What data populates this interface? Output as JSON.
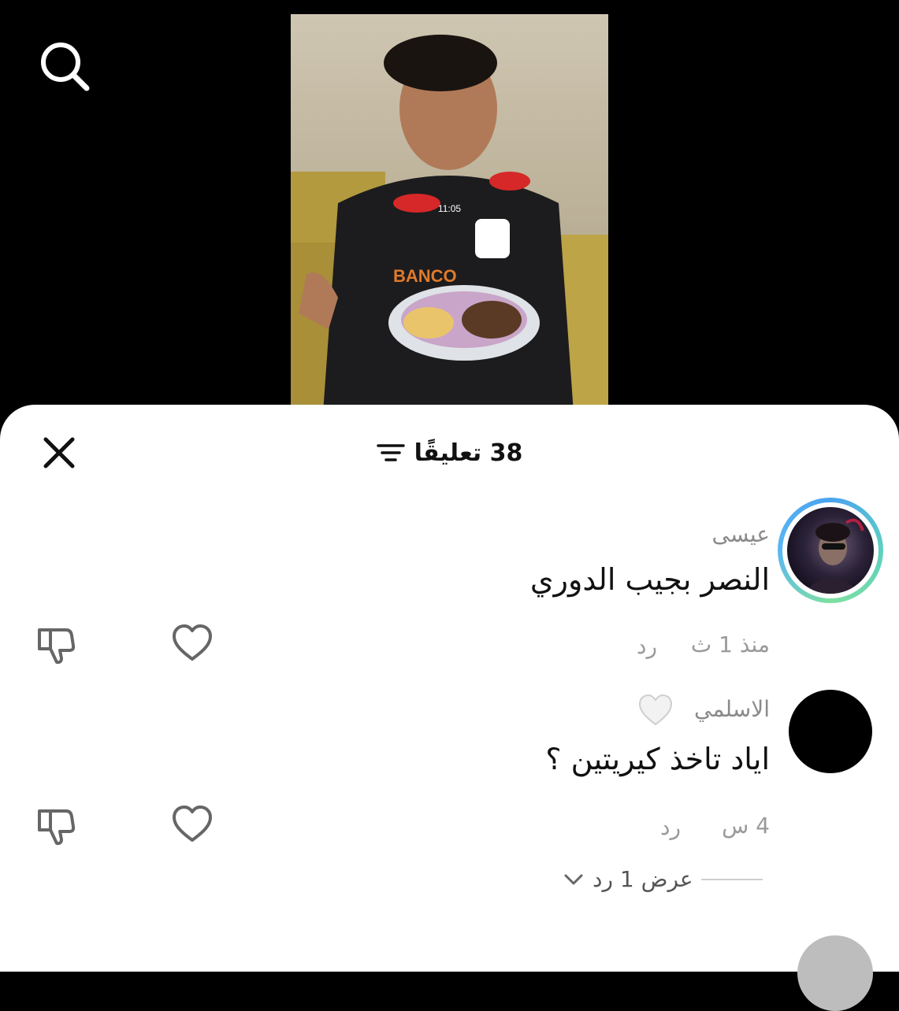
{
  "video": {
    "timestamp": "11:05"
  },
  "sheet": {
    "comment_count": "38 تعليقًا"
  },
  "comments": [
    {
      "author": "عيسى",
      "text": "النصر بجيب الدوري",
      "time": "منذ 1 ث",
      "reply_label": "رد"
    },
    {
      "author": "الاسلمي",
      "text": "اياد تاخذ كيريتين ؟",
      "time": "4 س",
      "reply_label": "رد",
      "view_replies": "عرض 1 رد"
    }
  ],
  "colors": {
    "sheet_bg": "#ffffff",
    "top_bg": "#000000",
    "muted_text": "#9a9a9a",
    "ring_gradient": [
      "#4aa3f0",
      "#7ee0a0"
    ]
  },
  "icons": {
    "search": "search-icon",
    "close": "close-icon",
    "filter": "filter-icon",
    "dislike": "thumbs-down-icon",
    "like": "heart-icon",
    "author_like": "white-heart-icon",
    "chevron": "chevron-down-icon"
  }
}
